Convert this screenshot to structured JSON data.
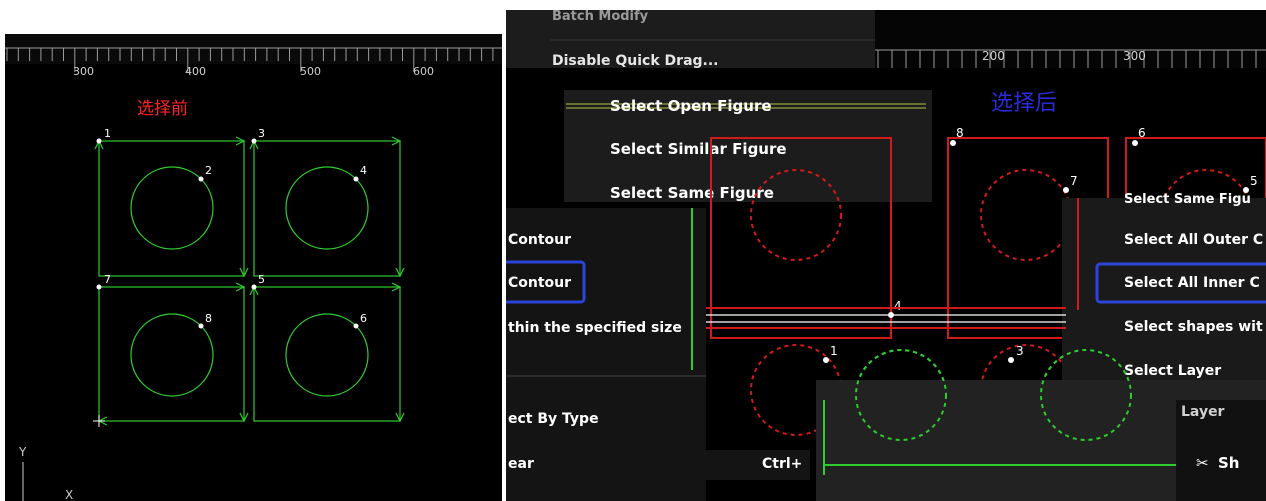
{
  "left": {
    "ruler_labels": [
      "300",
      "400",
      "500",
      "600"
    ],
    "title": "选择前",
    "point_labels": [
      "1",
      "2",
      "3",
      "4",
      "7",
      "5",
      "8",
      "6"
    ],
    "axis_labels": {
      "y": "Y",
      "x": "X"
    }
  },
  "right": {
    "menu": {
      "batch_modify": "Batch Modify",
      "disable_quick_drag": "Disable Quick Drag...",
      "select_open_figure": "Select Open Figure",
      "select_similar_figure": "Select Similar Figure",
      "select_same_figure": "Select Same Figure",
      "contour_outer": "Contour",
      "contour_inner": "Contour",
      "within_specified_size": "thin the specified size",
      "select_by_type": "ect By Type",
      "clear": "ear",
      "clear_shortcut": "Ctrl+",
      "select_all_outer": "Select All Outer C",
      "select_all_inner": "Select All Inner C",
      "select_shapes_within": "Select shapes wit",
      "select_layer": "Select Layer",
      "select_same_figure_top": "Select Same Figu",
      "layer_item": "Layer",
      "show_item": "Sh"
    },
    "ruler_labels": [
      "200",
      "300"
    ],
    "title": "选择后",
    "point_labels": [
      "8",
      "6",
      "7",
      "5",
      "4",
      "1",
      "3"
    ]
  },
  "colors": {
    "green": "#2ecc2e",
    "red_dashed": "#d11a1a",
    "title_red": "#ff2222",
    "title_blue": "#2a2ad8",
    "menu_bg": "#1c1c1c",
    "highlight_border": "#2c44d8"
  }
}
